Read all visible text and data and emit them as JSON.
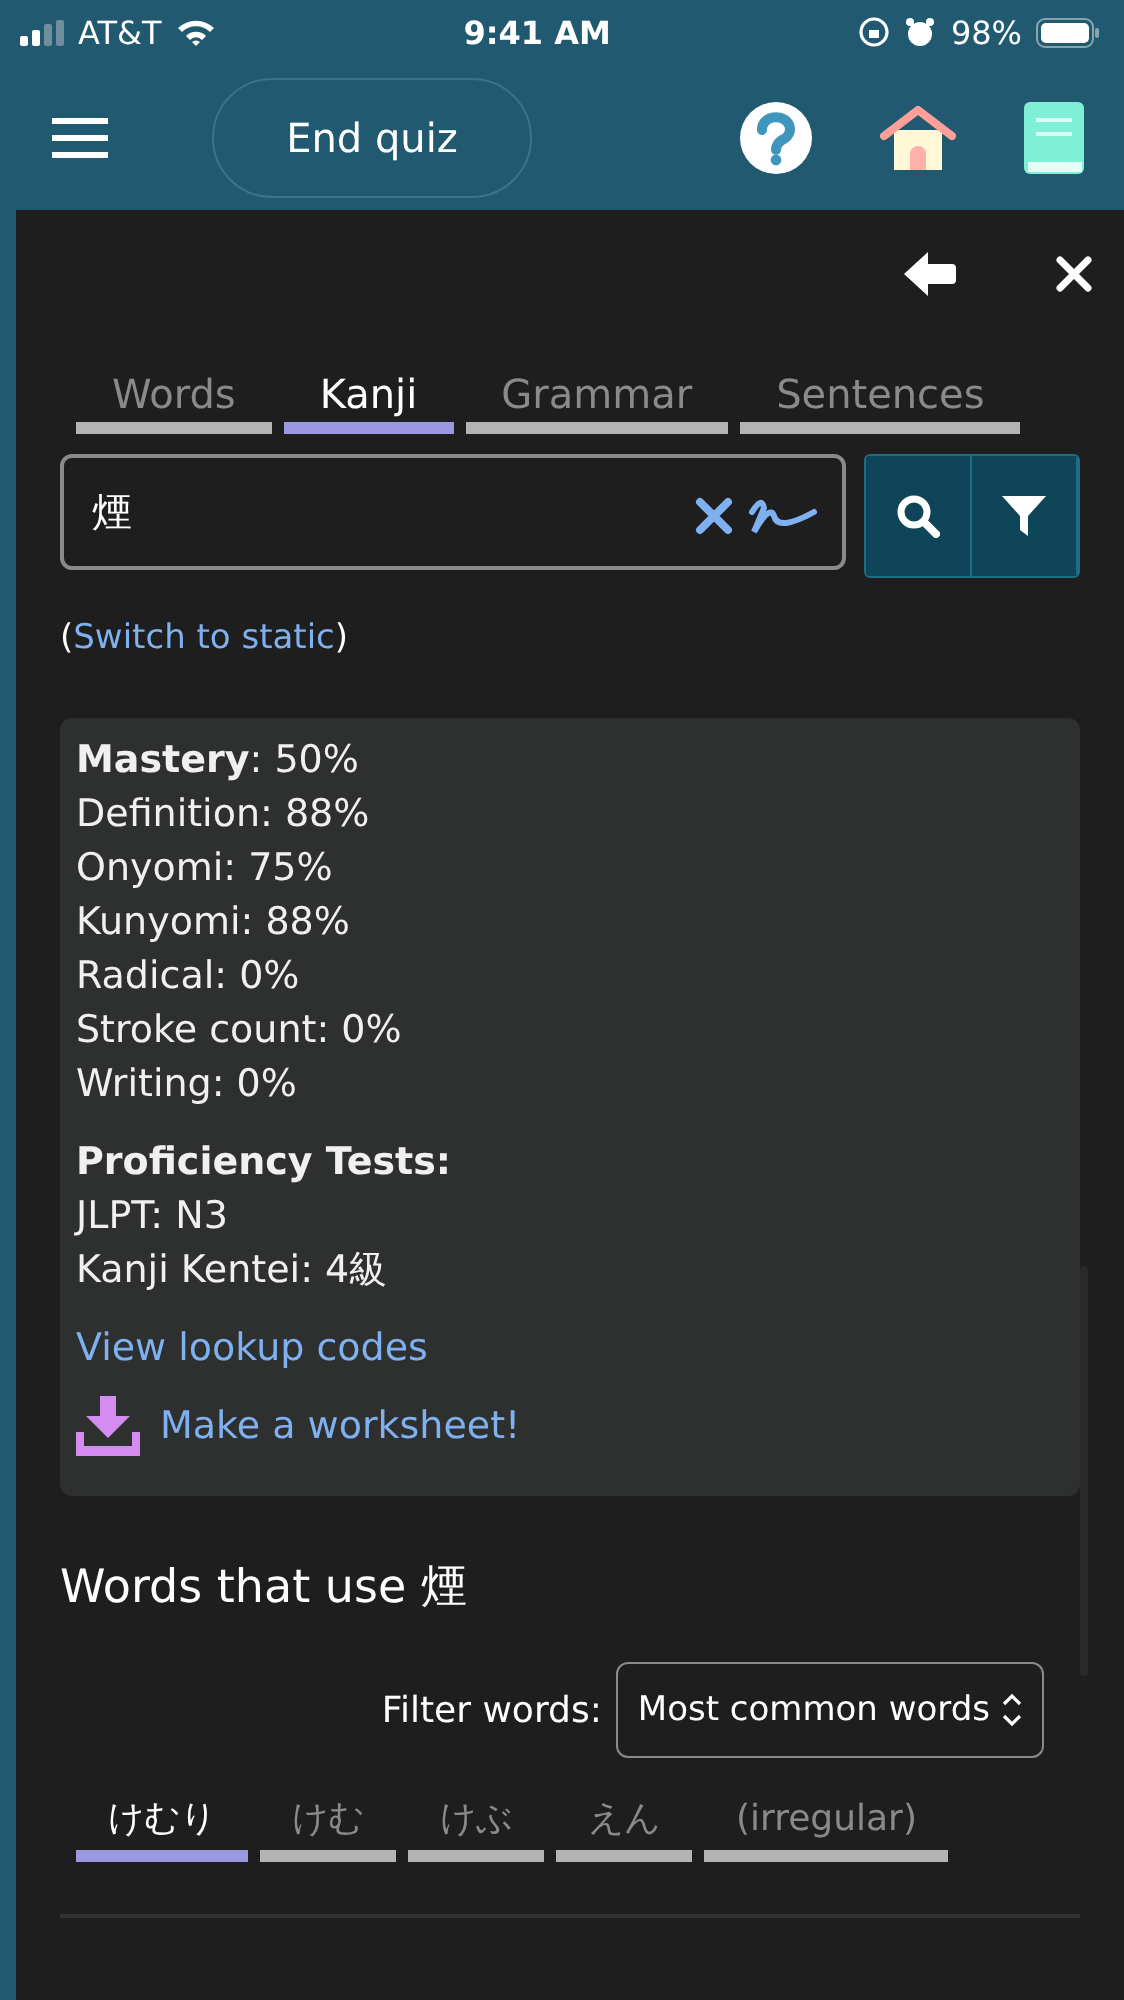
{
  "status_bar": {
    "carrier": "AT&T",
    "time": "9:41 AM",
    "battery": "98%"
  },
  "nav": {
    "end_button": "End quiz"
  },
  "tabs": [
    {
      "label": "Words",
      "selected": false
    },
    {
      "label": "Kanji",
      "selected": true
    },
    {
      "label": "Grammar",
      "selected": false
    },
    {
      "label": "Sentences",
      "selected": false
    }
  ],
  "search": {
    "value": "煙"
  },
  "switch_link": {
    "open": "(",
    "link": "Switch to static",
    "close": ")"
  },
  "stats": [
    "**Mastery**: 50%",
    "Definition: 88%",
    "Onyomi: 75%",
    "Kunyomi: 88%",
    "Radical: 0%",
    "Stroke count: 0%",
    "Writing: 0%"
  ],
  "proficiency": {
    "title": "Proficiency Tests:",
    "items": [
      "JLPT: N3",
      "Kanji Kentei: 4級"
    ]
  },
  "lookup_link": "View lookup codes",
  "worksheet_link": "Make a worksheet!",
  "words_heading": "Words that use 煙",
  "filter": {
    "label": "Filter words:",
    "value": "Most common words"
  },
  "readings": [
    {
      "label": "けむり",
      "selected": true
    },
    {
      "label": "けむ",
      "selected": false
    },
    {
      "label": "けぶ",
      "selected": false
    },
    {
      "label": "えん",
      "selected": false
    },
    {
      "label": "(irregular)",
      "selected": false
    }
  ]
}
